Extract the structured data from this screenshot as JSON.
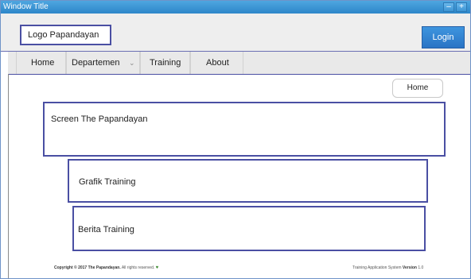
{
  "window": {
    "title": "Window Title",
    "minimize_glyph": "–",
    "maximize_glyph": "+"
  },
  "header": {
    "logo_text": "Logo Papandayan",
    "login_label": "Login"
  },
  "nav": {
    "items": [
      {
        "label": "Home"
      },
      {
        "label": "Departemen",
        "has_dropdown": true
      },
      {
        "label": "Training"
      },
      {
        "label": "About"
      }
    ],
    "dropdown_glyph": "⌄"
  },
  "breadcrumb": {
    "label": "Home"
  },
  "panels": {
    "screen": "Screen The Papandayan",
    "grafik": "Grafik Training",
    "berita": "Berita Training"
  },
  "footer": {
    "copyright_prefix": "Copyright © 2017",
    "company": "The Papandayan.",
    "rights": "All rights reserved.",
    "heart_glyph": "♥",
    "system_label": "Training Application System",
    "version_label": "Version",
    "version_number": "1.0"
  },
  "colors": {
    "titlebar": "#3597d6",
    "accent_border": "#4a4fa3",
    "login_button": "#3484d2"
  }
}
